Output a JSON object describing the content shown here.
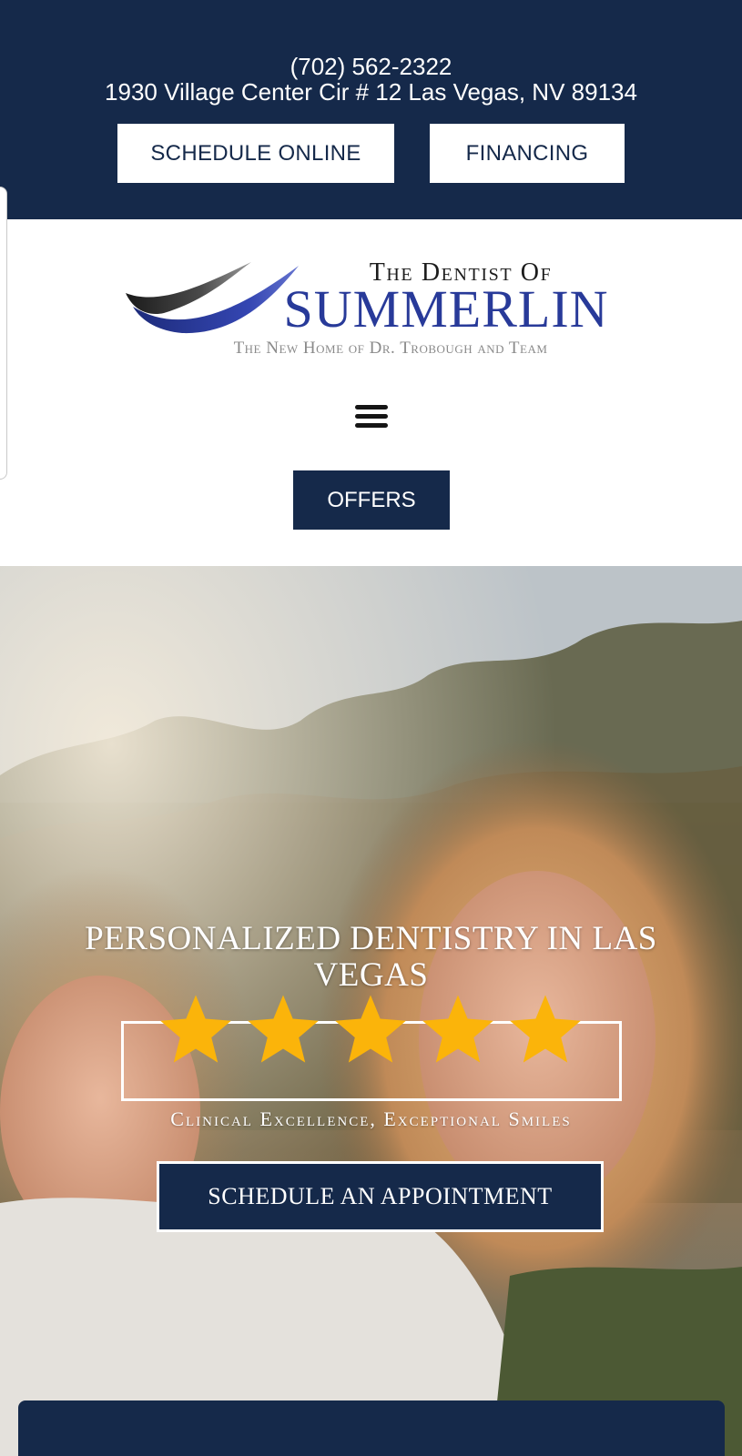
{
  "topbar": {
    "phone": "(702) 562-2322",
    "address": "1930 Village Center Cir # 12 Las Vegas, NV 89134",
    "schedule_label": "SCHEDULE ONLINE",
    "financing_label": "FINANCING"
  },
  "logo": {
    "top_line": "The Dentist Of",
    "main_line": "SUMMERLIN",
    "sub_line": "The New Home of Dr. Trobough and Team"
  },
  "nav": {
    "menu_icon": "hamburger-menu-icon",
    "offers_label": "OFFERS"
  },
  "hero": {
    "title": "PERSONALIZED DENTISTRY IN LAS VEGAS",
    "rating_stars": 5,
    "tagline": "Clinical Excellence, Exceptional Smiles",
    "appointment_label": "SCHEDULE AN APPOINTMENT"
  },
  "colors": {
    "navy": "#15294a",
    "logo_blue": "#283a99",
    "star_gold": "#fbb40a",
    "white": "#ffffff"
  }
}
